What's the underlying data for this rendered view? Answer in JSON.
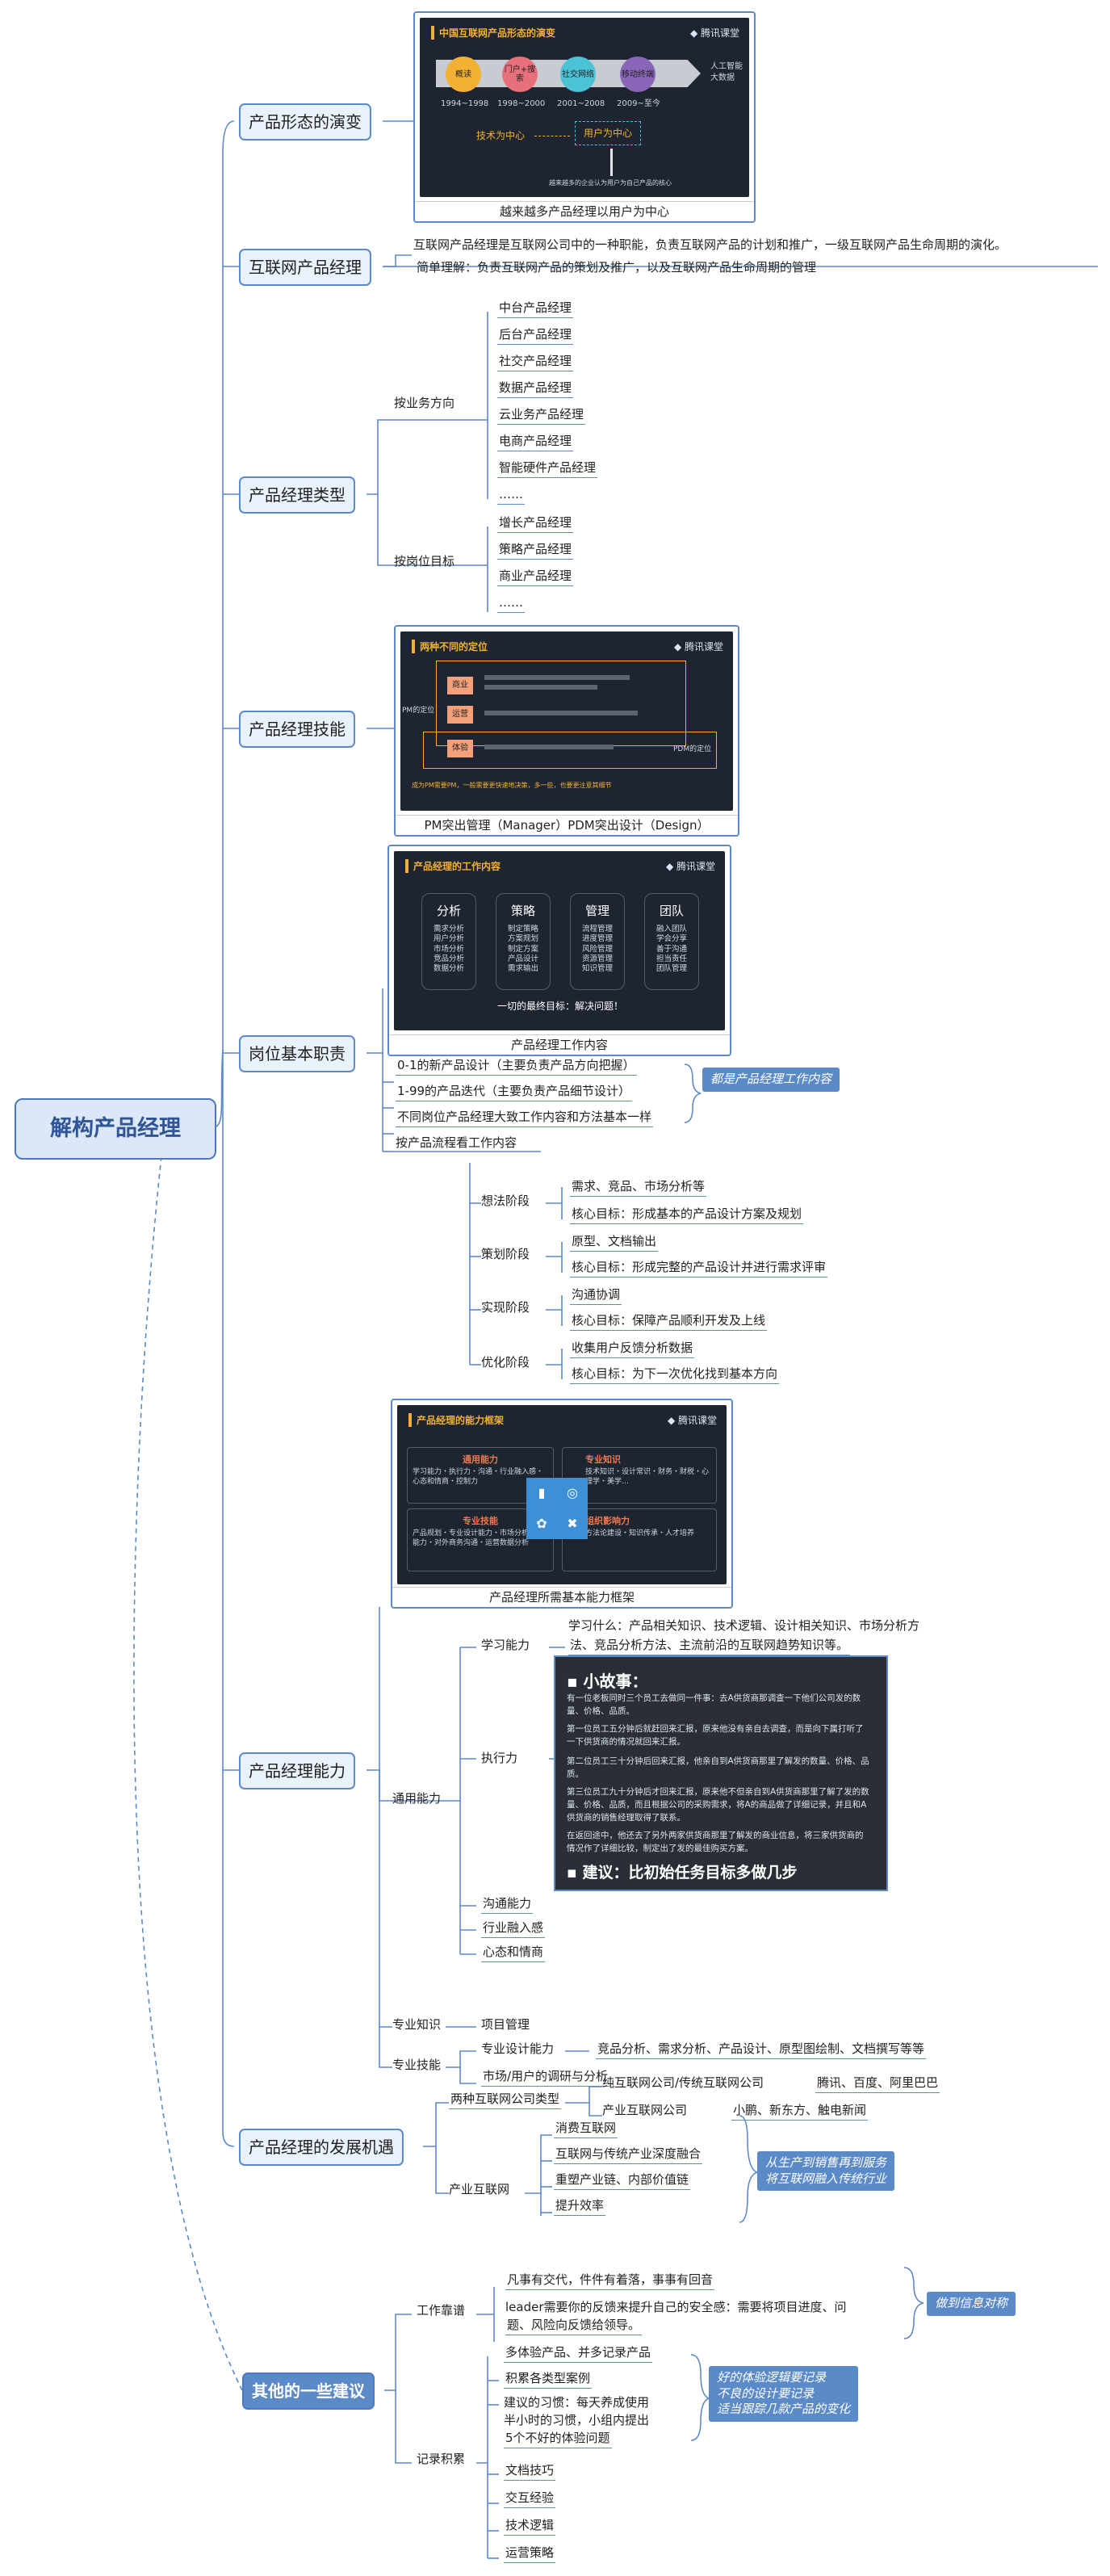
{
  "root": "解构产品经理",
  "branches": {
    "b1": "产品形态的演变",
    "b2": "互联网产品经理",
    "b3": "产品经理类型",
    "b4": "产品经理技能",
    "b5": "岗位基本职责",
    "b6": "产品经理能力",
    "b7": "产品经理的发展机遇",
    "b8": "其他的一些建议"
  },
  "evolution": {
    "slide_title": "中国互联网产品形态的演变",
    "brand": "腾讯课堂",
    "stages": [
      "概读",
      "门户+搜索",
      "社交网络",
      "移动终端"
    ],
    "years": [
      "1994~1998",
      "1998~2000",
      "2001~2008",
      "2009~至今"
    ],
    "right_note": "人工智能 大数据",
    "tech_center": "技术为中心",
    "user_center": "用户为中心",
    "bottom_note": "越来越多的企业认为用户为自己产品的核心",
    "caption": "越来越多产品经理以用户为中心"
  },
  "internet_pm": {
    "definition": "互联网产品经理是互联网公司中的一种职能，负责互联网产品的计划和推广，一级互联网产品生命周期的演化。",
    "simple": "简单理解：负责互联网产品的策划及推广，以及互联网产品生命周期的管理"
  },
  "types": {
    "by_business": "按业务方向",
    "business_items": [
      "中台产品经理",
      "后台产品经理",
      "社交产品经理",
      "数据产品经理",
      "云业务产品经理",
      "电商产品经理",
      "智能硬件产品经理",
      "……"
    ],
    "by_goal": "按岗位目标",
    "goal_items": [
      "增长产品经理",
      "策略产品经理",
      "商业产品经理",
      "……"
    ]
  },
  "skills": {
    "slide_title": "两种不同的定位",
    "brand": "腾讯课堂",
    "rows": [
      "商业",
      "运营",
      "体验"
    ],
    "pm_label": "PM的定位",
    "pdm_label": "PDM的定位",
    "bottom": "成为PM需要PM，一般需要更快速地决策，多一些，也要更注意其细节",
    "caption": "PM突出管理（Manager）PDM突出设计（Design）"
  },
  "duties": {
    "slide_title": "产品经理的工作内容",
    "brand": "腾讯课堂",
    "cards": [
      {
        "title": "分析",
        "lines": "需求分析\n用户分析\n市场分析\n竞品分析\n数据分析"
      },
      {
        "title": "策略",
        "lines": "制定策略\n方案规划\n制定方案\n产品设计\n需求输出"
      },
      {
        "title": "管理",
        "lines": "流程管理\n进度管理\n风险管理\n资源管理\n知识管理"
      },
      {
        "title": "团队",
        "lines": "融入团队\n学会分享\n善于沟通\n担当责任\n团队管理"
      }
    ],
    "goal": "一切的最终目标：解决问题！",
    "caption": "产品经理工作内容",
    "new_design": "0-1的新产品设计（主要负责产品方向把握）",
    "iteration": "1-99的产品迭代（主要负责产品细节设计）",
    "callout": "都是产品经理工作内容",
    "different": "不同岗位产品经理大致工作内容和方法基本一样",
    "by_process": "按产品流程看工作内容",
    "stages": [
      {
        "name": "想法阶段",
        "a": "需求、竞品、市场分析等",
        "b": "核心目标：形成基本的产品设计方案及规划"
      },
      {
        "name": "策划阶段",
        "a": "原型、文档输出",
        "b": "核心目标：形成完整的产品设计并进行需求评审"
      },
      {
        "name": "实现阶段",
        "a": "沟通协调",
        "b": "核心目标：保障产品顺利开发及上线"
      },
      {
        "name": "优化阶段",
        "a": "收集用户反馈分析数据",
        "b": "核心目标：为下一次优化找到基本方向"
      }
    ]
  },
  "abilities": {
    "slide_title": "产品经理的能力框架",
    "brand": "腾讯课堂",
    "quads": [
      {
        "title": "通用能力",
        "text": "学习能力・执行力・沟通・行业融入感・心态和情商・控制力"
      },
      {
        "title": "专业知识",
        "text": "技术知识・设计常识・财务・财税・心理学・美学…"
      },
      {
        "title": "专业技能",
        "text": "产品规划・专业设计能力・市场分析能力・对外商务沟通・运营数据分析"
      },
      {
        "title": "组织影响力",
        "text": "方法论建设・知识传承・人才培养"
      }
    ],
    "caption": "产品经理所需基本能力框架",
    "general": "通用能力",
    "learning": "学习能力",
    "learning_desc_1": "学习什么：产品相关知识、技术逻辑、设计相关知识、市场分析方",
    "learning_desc_2": "法、竞品分析方法、主流前沿的互联网趋势知识等。",
    "execution": "执行力",
    "story_title": "小故事：",
    "story_lines": [
      "有一位老板同时三个员工去做同一件事：去A供货商那调查一下他们公司发的数量、价格、品质。",
      "第一位员工五分钟后就赶回来汇报，原来他没有亲自去调查，而是向下属打听了一下供货商的情况就回来汇报。",
      "第二位员工三十分钟后回来汇报，他亲自到A供货商那里了解发的数量、价格、品质。",
      "第三位员工九十分钟后才回来汇报，原来他不但亲自到A供货商那里了解了发的数量、价格、品质，而且根据公司的采购需求，将A的商品做了详细记录，并且和A供货商的销售经理取得了联系。",
      "在返回途中，他还去了另外两家供货商那里了解发的商业信息，将三家供货商的情况作了详细比较，制定出了发的最佳购买方案。"
    ],
    "story_advice": "建议：比初始任务目标多做几步",
    "communication": "沟通能力",
    "industry": "行业融入感",
    "mindset": "心态和情商",
    "knowledge": "专业知识",
    "project": "项目管理",
    "skills": "专业技能",
    "design": "专业设计能力",
    "design_desc": "竞品分析、需求分析、产品设计、原型图绘制、文档撰写等等",
    "market": "市场/用户的调研与分析"
  },
  "opportunities": {
    "two_types": "两种互联网公司类型",
    "pure": "纯互联网公司/传统互联网公司",
    "pure_ex": "腾讯、百度、阿里巴巴",
    "industrial": "产业互联网公司",
    "industrial_ex": "小鹏、新东方、触电新闻",
    "industrial_net": "产业互联网",
    "items": [
      "消费互联网",
      "互联网与传统产业深度融合",
      "重塑产业链、内部价值链",
      "提升效率"
    ],
    "callout_1": "从生产到销售再到服务",
    "callout_2": "将互联网融入传统行业"
  },
  "advice": {
    "work": "工作靠谱",
    "w1": "凡事有交代，件件有着落，事事有回音",
    "w2a": "leader需要你的反馈来提升自己的安全感：需要将项目进度、问",
    "w2b": "题、风险向反馈给领导。",
    "work_callout": "做到信息对称",
    "record": "记录积累",
    "r1": "多体验产品、并多记录产品",
    "r2": "积累各类型案例",
    "r3a": "建议的习惯：每天养成使用",
    "r3b": "半小时的习惯，小组内提出",
    "r3c": "5个不好的体验问题",
    "record_callout": [
      "好的体验逻辑要记录",
      "不良的设计要记录",
      "适当跟踪几款产品的变化"
    ],
    "r4": "文档技巧",
    "r5": "交互经验",
    "r6": "技术逻辑",
    "r7": "运营策略"
  }
}
